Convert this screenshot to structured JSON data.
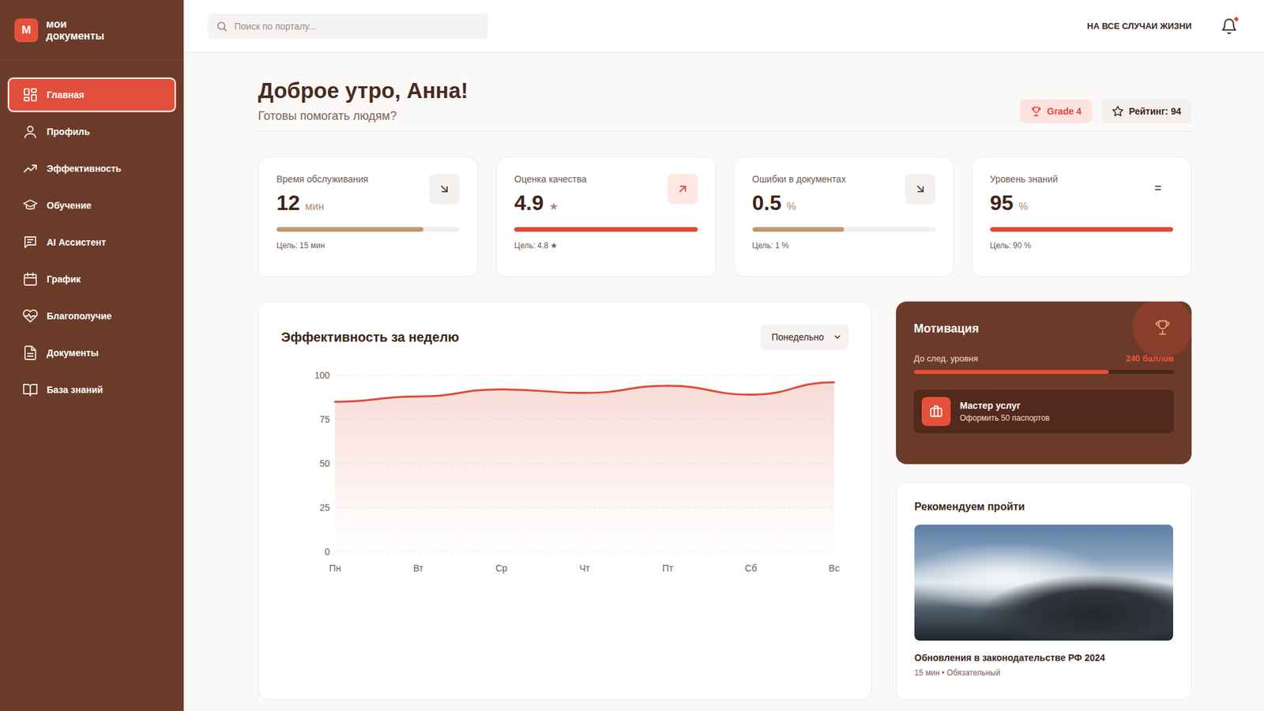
{
  "logo": {
    "mark": "М",
    "lines": [
      "мои",
      "документы"
    ]
  },
  "sidebar": {
    "items": [
      {
        "label": "Главная",
        "selected": true
      },
      {
        "label": "Профиль",
        "selected": false
      },
      {
        "label": "Эффективность",
        "selected": false
      },
      {
        "label": "Обучение",
        "selected": false
      },
      {
        "label": "AI Ассистент",
        "selected": false
      },
      {
        "label": "График",
        "selected": false
      },
      {
        "label": "Благополучие",
        "selected": false
      },
      {
        "label": "Документы",
        "selected": false
      },
      {
        "label": "База знаний",
        "selected": false
      }
    ]
  },
  "topbar": {
    "search": {
      "placeholder": "Поиск по порталу..."
    },
    "link": "НА ВСЕ СЛУЧАИ ЖИЗНИ",
    "notifications": {
      "unread": true
    }
  },
  "header": {
    "title": "Доброе утро, Анна!",
    "subtitle": "Готовы помогать людям?",
    "badges": [
      {
        "label": "Grade 4",
        "kind": "grade"
      },
      {
        "label": "Рейтинг: 94",
        "kind": "rating"
      }
    ]
  },
  "stats": [
    {
      "label": "Время обслуживания",
      "value": "12",
      "unit": "мин",
      "goal": "Цель: 15 мин",
      "level": 0.8,
      "color": "#c4966c",
      "kind": "down"
    },
    {
      "label": "Оценка качества",
      "value": "4.9",
      "unit": "★",
      "goal": "Цель: 4.8 ★",
      "level": 1.0,
      "color": "#e04a36",
      "kind": "up"
    },
    {
      "label": "Ошибки в документах",
      "value": "0.5",
      "unit": "%",
      "goal": "Цель: 1 %",
      "level": 0.5,
      "color": "#c4966c",
      "kind": "down"
    },
    {
      "label": "Уровень знаний",
      "value": "95",
      "unit": "%",
      "goal": "Цель: 90 %",
      "level": 1.0,
      "color": "#e04a36",
      "kind": "flat",
      "symbol": "="
    }
  ],
  "chart": {
    "title": "Эффективность за неделю",
    "period": {
      "label": "Понедельно"
    },
    "y_ticks": [
      "100",
      "75",
      "50",
      "25",
      "0"
    ],
    "x_labels": [
      "Пн",
      "Вт",
      "Ср",
      "Чт",
      "Пт",
      "Сб",
      "Вс"
    ],
    "series": [
      {
        "values": [
          85,
          88,
          92,
          90,
          94,
          89,
          96
        ]
      }
    ]
  },
  "motivation": {
    "title": "Мотивация",
    "progress_label": "До след. уровня",
    "points": "240 баллов",
    "level": 0.75,
    "achievement": {
      "title": "Мастер услуг",
      "subtitle": "Оформить 50 паспортов"
    }
  },
  "recommend": {
    "title": "Рекомендуем пройти",
    "course": {
      "title": "Обновления в законодательстве РФ 2024",
      "meta": "15 мин • Обязательный"
    }
  }
}
